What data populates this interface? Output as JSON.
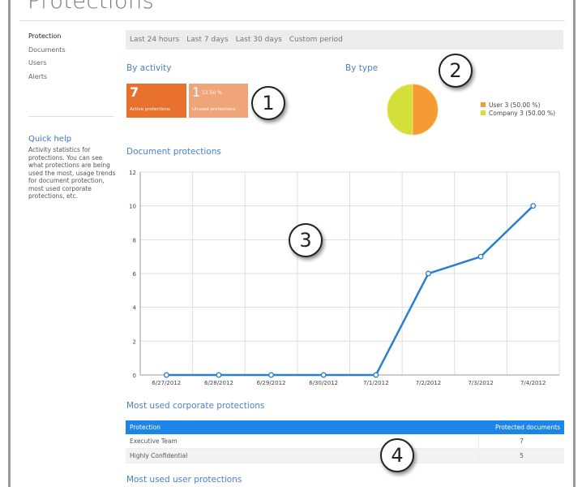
{
  "page_title": "Protections",
  "sidebar": {
    "items": [
      {
        "label": "Protection",
        "active": true
      },
      {
        "label": "Documents"
      },
      {
        "label": "Users"
      },
      {
        "label": "Alerts"
      }
    ]
  },
  "quick_help": {
    "title": "Quick help",
    "text": "Activity statistics for protections. You can see what protections are being used the most, usage trends for document protection, most used corporate protections, etc."
  },
  "filters": [
    "Last 24 hours",
    "Last 7 days",
    "Last 30 days",
    "Custom period"
  ],
  "by_activity": {
    "title": "By activity",
    "tiles": [
      {
        "value": "7",
        "label": "Active protections",
        "color": "#e8722d"
      },
      {
        "value": "1",
        "percent": "12.50 %",
        "label": "Unused protections",
        "color": "#f0a47a"
      }
    ]
  },
  "by_type": {
    "title": "By type"
  },
  "annotations": [
    "1",
    "2",
    "3",
    "4"
  ],
  "document_protections": {
    "title": "Document protections"
  },
  "chart_data": [
    {
      "type": "pie",
      "slices": [
        {
          "label": "User 3 (50.00 %)",
          "value": 3,
          "color": "#f59a35"
        },
        {
          "label": "Company 3 (50.00 %)",
          "value": 3,
          "color": "#d4e03a"
        }
      ],
      "legend": "right"
    },
    {
      "type": "line",
      "categories": [
        "6/27/2012",
        "6/28/2012",
        "6/29/2012",
        "6/30/2012",
        "7/1/2012",
        "7/2/2012",
        "7/3/2012",
        "7/4/2012"
      ],
      "values": [
        0,
        0,
        0,
        0,
        0,
        6,
        7,
        10
      ],
      "ylim": [
        0,
        12
      ],
      "yticks": [
        0,
        2,
        4,
        6,
        8,
        10,
        12
      ],
      "grid": true,
      "color": "#2a7fcf"
    }
  ],
  "corporate": {
    "title": "Most used corporate protections",
    "columns": [
      "Protection",
      "Protected documents"
    ],
    "rows": [
      [
        "Executive Team",
        "7"
      ],
      [
        "Highly Confidential",
        "5"
      ]
    ]
  },
  "user_protections": {
    "title": "Most used user protections"
  }
}
